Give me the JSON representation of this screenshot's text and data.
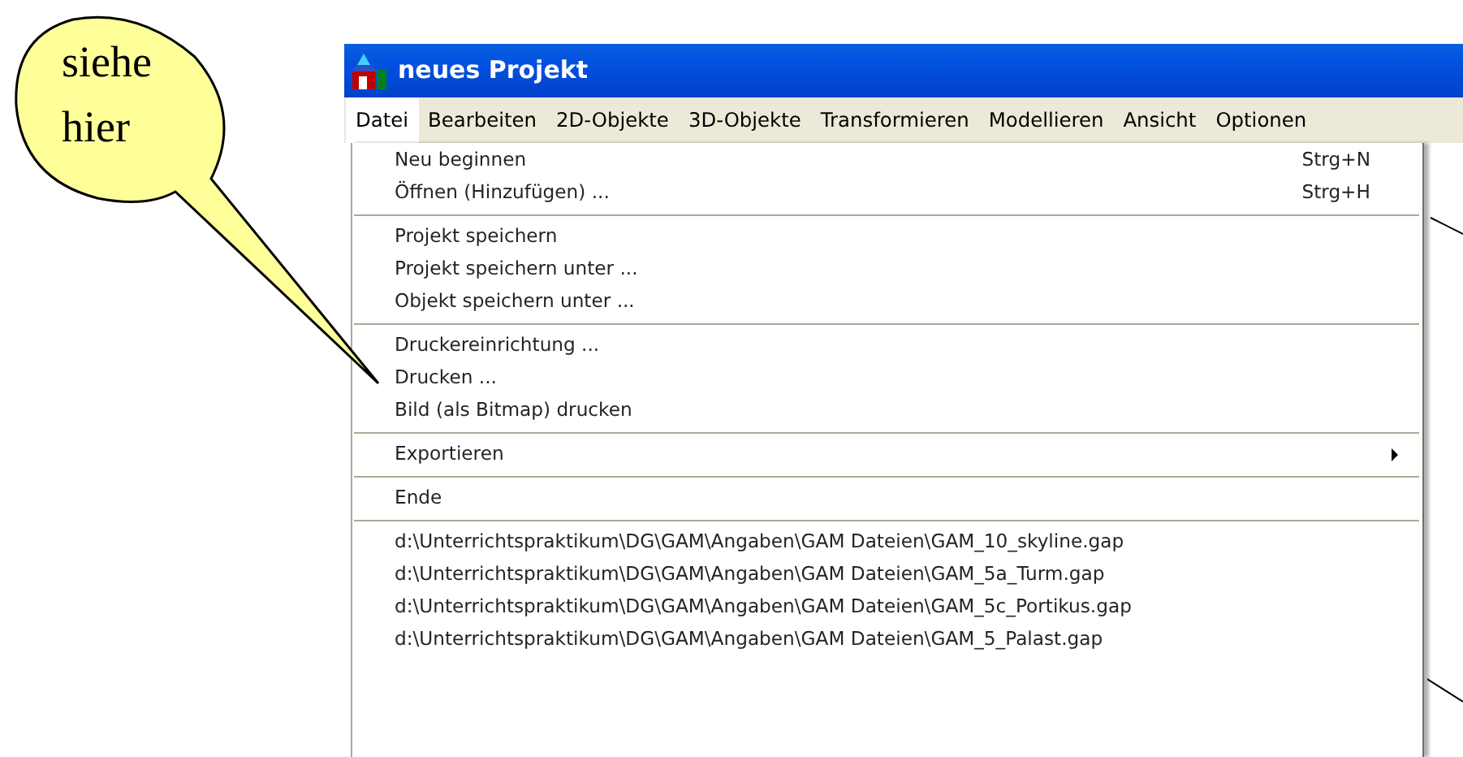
{
  "callout": {
    "text": "siehe hier"
  },
  "window": {
    "title": "neues Projekt"
  },
  "menu_bar": [
    {
      "label": "Datei",
      "selected": true
    },
    {
      "label": "Bearbeiten",
      "selected": false
    },
    {
      "label": "2D-Objekte",
      "selected": false
    },
    {
      "label": "3D-Objekte",
      "selected": false
    },
    {
      "label": "Transformieren",
      "selected": false
    },
    {
      "label": "Modellieren",
      "selected": false
    },
    {
      "label": "Ansicht",
      "selected": false
    },
    {
      "label": "Optionen",
      "selected": false
    }
  ],
  "menu": [
    {
      "kind": "item",
      "label": "Neu beginnen",
      "shortcut": "Strg+N"
    },
    {
      "kind": "item",
      "label": "Öffnen (Hinzufügen) ...",
      "shortcut": "Strg+H"
    },
    {
      "kind": "separator"
    },
    {
      "kind": "item",
      "label": "Projekt speichern"
    },
    {
      "kind": "item",
      "label": "Projekt speichern unter ..."
    },
    {
      "kind": "item",
      "label": "Objekt speichern unter ..."
    },
    {
      "kind": "separator"
    },
    {
      "kind": "item",
      "label": "Druckereinrichtung ..."
    },
    {
      "kind": "item",
      "label": "Drucken ..."
    },
    {
      "kind": "item",
      "label": "Bild (als Bitmap) drucken"
    },
    {
      "kind": "separator"
    },
    {
      "kind": "submenu",
      "label": "Exportieren"
    },
    {
      "kind": "separator"
    },
    {
      "kind": "item",
      "label": "Ende"
    },
    {
      "kind": "separator"
    },
    {
      "kind": "item",
      "label": "d:\\Unterrichtspraktikum\\DG\\GAM\\Angaben\\GAM Dateien\\GAM_10_skyline.gap"
    },
    {
      "kind": "item",
      "label": "d:\\Unterrichtspraktikum\\DG\\GAM\\Angaben\\GAM Dateien\\GAM_5a_Turm.gap"
    },
    {
      "kind": "item",
      "label": "d:\\Unterrichtspraktikum\\DG\\GAM\\Angaben\\GAM Dateien\\GAM_5c_Portikus.gap"
    },
    {
      "kind": "item",
      "label": "d:\\Unterrichtspraktikum\\DG\\GAM\\Angaben\\GAM Dateien\\GAM_5_Palast.gap"
    }
  ]
}
